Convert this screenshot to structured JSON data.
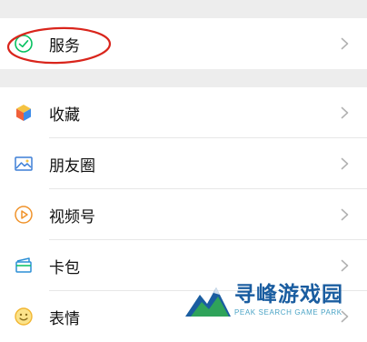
{
  "menu": {
    "service": {
      "label": "服务",
      "icon": "service-icon"
    },
    "items": [
      {
        "label": "收藏",
        "icon": "favorites-icon"
      },
      {
        "label": "朋友圈",
        "icon": "moments-icon"
      },
      {
        "label": "视频号",
        "icon": "channels-icon"
      },
      {
        "label": "卡包",
        "icon": "cards-icon"
      },
      {
        "label": "表情",
        "icon": "stickers-icon"
      }
    ]
  },
  "annotation": {
    "color": "#d9251c"
  },
  "watermark": {
    "title": "寻峰游戏园",
    "subtitle": "PEAK SEARCH GAME PARK"
  },
  "colors": {
    "background": "#ededed",
    "row": "#ffffff",
    "wechat_green": "#07c160",
    "chevron": "#b2b2b2"
  }
}
